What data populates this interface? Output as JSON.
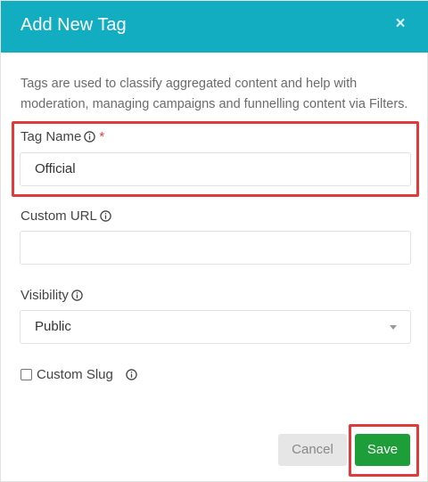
{
  "modal": {
    "title": "Add New Tag",
    "close_symbol": "×",
    "description": "Tags are used to classify aggregated content and help with moderation, managing campaigns and funnelling content via Filters."
  },
  "fields": {
    "tag_name": {
      "label": "Tag Name",
      "required_marker": "*",
      "value": "Official"
    },
    "custom_url": {
      "label": "Custom URL",
      "value": ""
    },
    "visibility": {
      "label": "Visibility",
      "selected": "Public"
    },
    "custom_slug": {
      "label": "Custom Slug",
      "checked": false
    }
  },
  "buttons": {
    "cancel": "Cancel",
    "save": "Save"
  },
  "colors": {
    "header": "#12adc1",
    "save": "#1e9e38",
    "highlight": "#e03a3a",
    "required": "#e53935"
  },
  "icons": [
    "close-icon",
    "info-icon",
    "chevron-down-icon",
    "checkbox-icon"
  ]
}
